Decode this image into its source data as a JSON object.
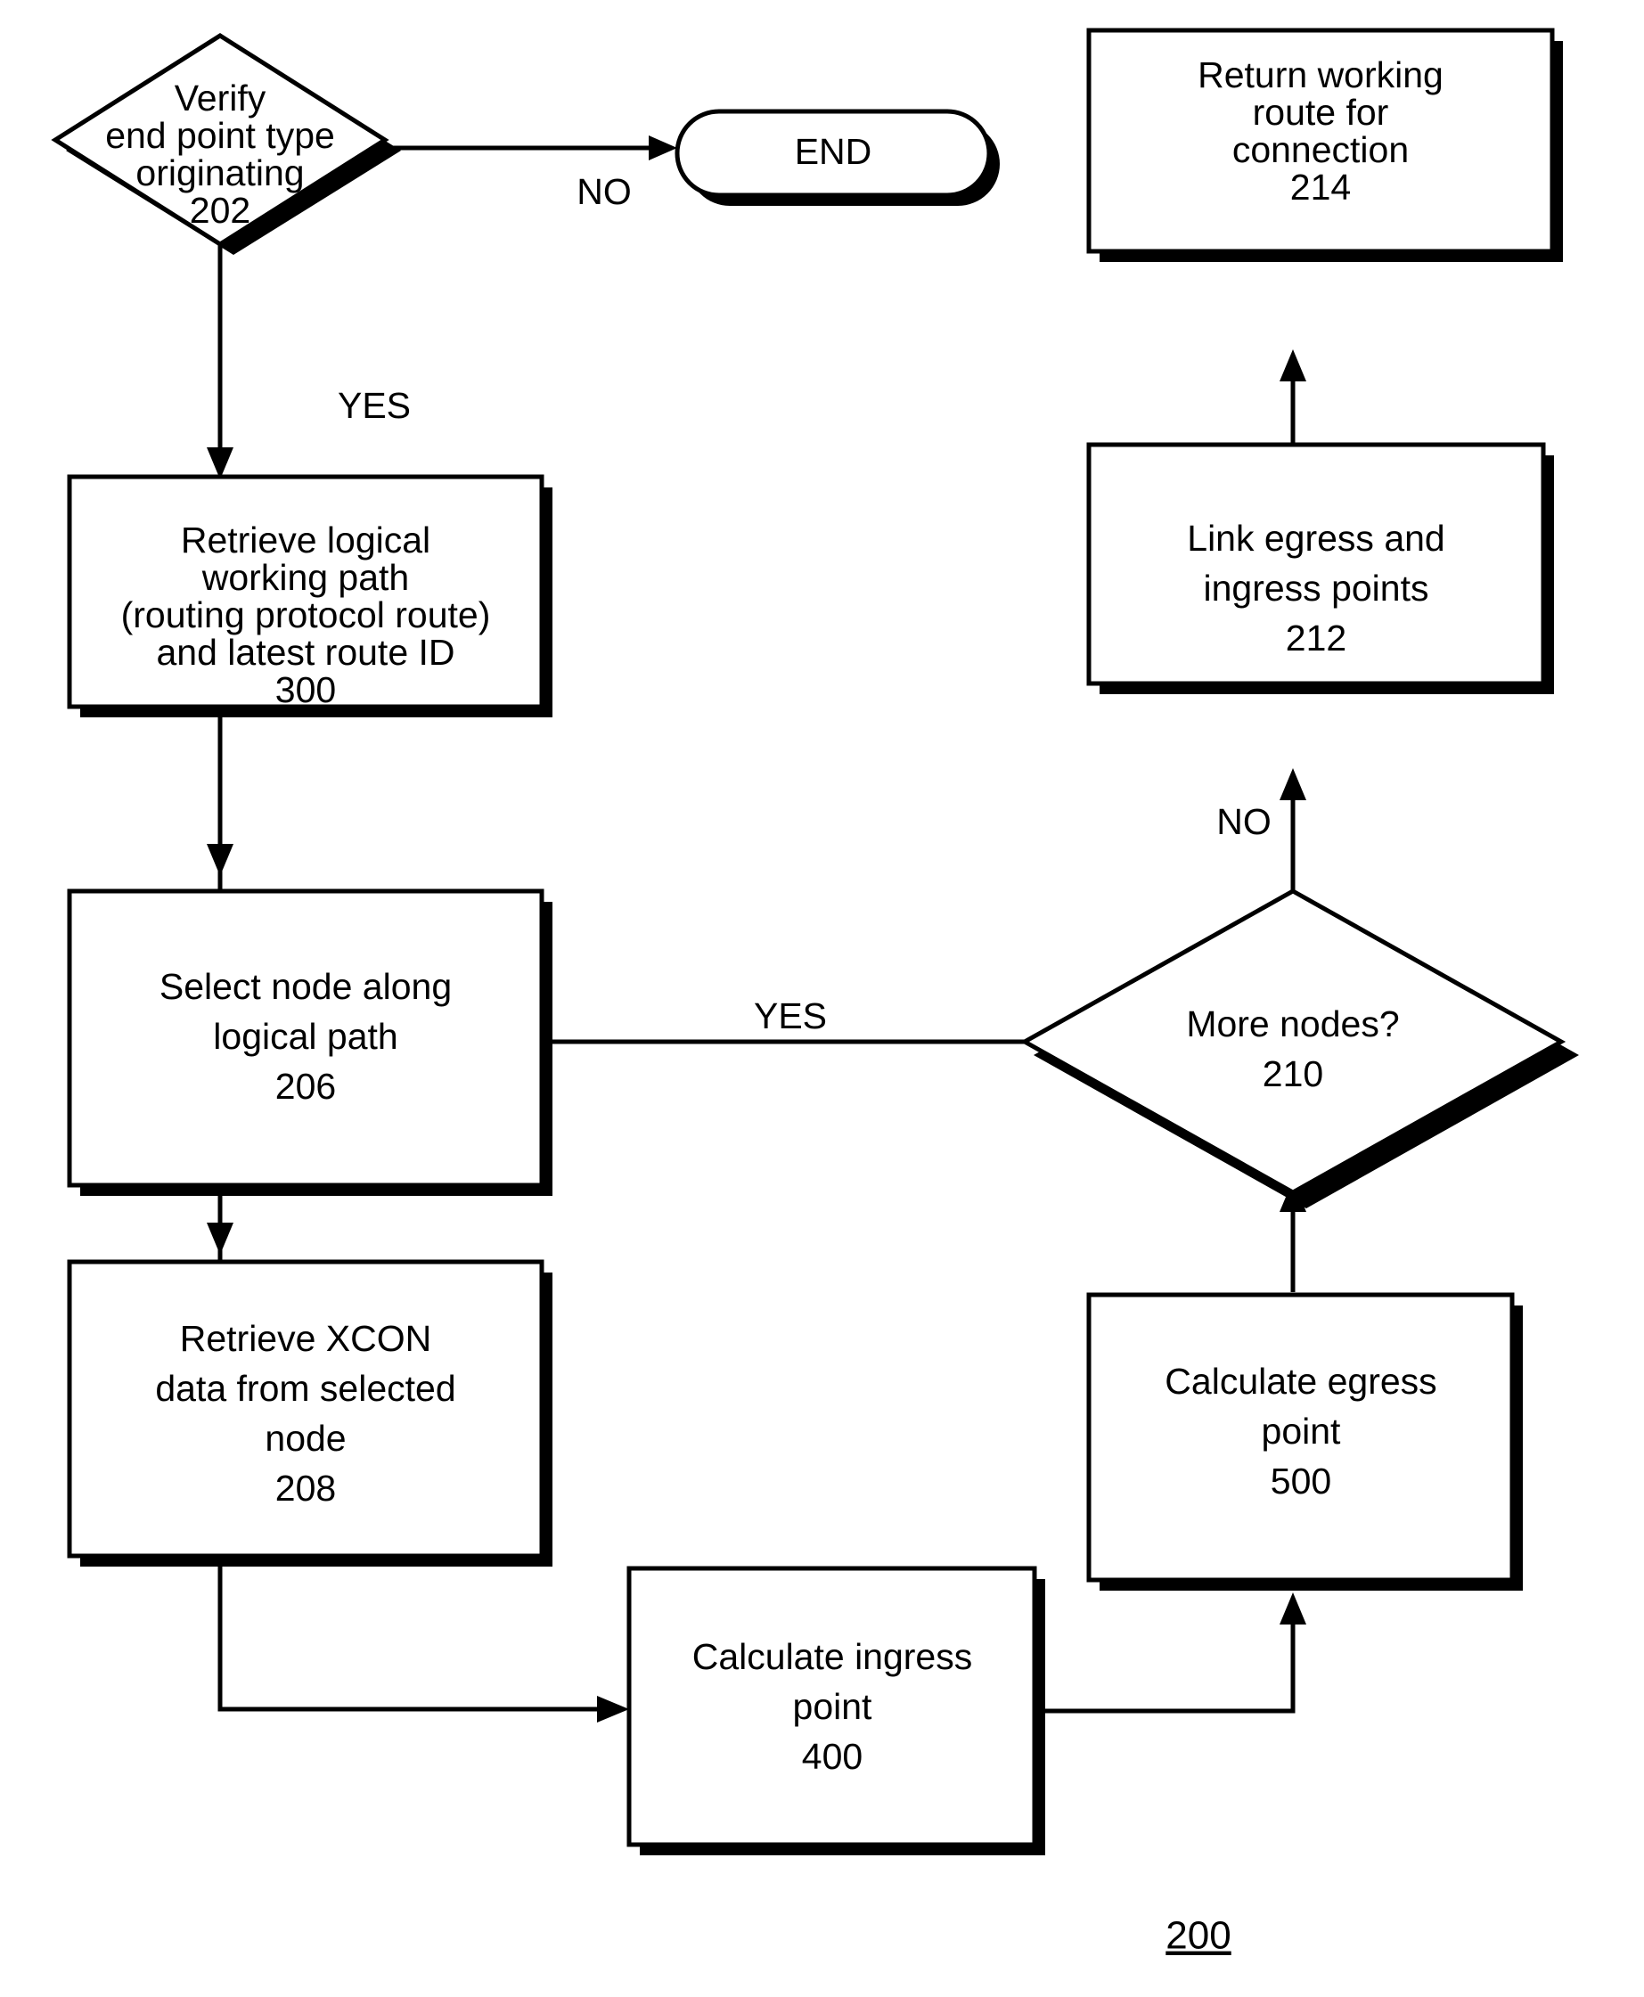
{
  "figure": {
    "number": "200",
    "type": "flowchart",
    "background_color": "#ffffff",
    "line_color": "#000000"
  },
  "nodes": {
    "verify": {
      "shape": "decision",
      "lines": [
        "Verify",
        "end point type",
        "originating",
        "202"
      ],
      "ref": "202"
    },
    "end": {
      "shape": "terminator",
      "lines": [
        "END"
      ],
      "ref": ""
    },
    "return_route": {
      "shape": "process",
      "lines": [
        "Return working",
        "route for",
        "connection",
        "214"
      ],
      "ref": "214"
    },
    "retrieve_path": {
      "shape": "process",
      "lines": [
        "Retrieve logical",
        "working path",
        "(routing protocol route)",
        "and latest route ID",
        "300"
      ],
      "ref": "300"
    },
    "link_points": {
      "shape": "process",
      "lines": [
        "Link egress and",
        "ingress points",
        "212"
      ],
      "ref": "212"
    },
    "select_node": {
      "shape": "process",
      "lines": [
        "Select node along",
        "logical path",
        "206"
      ],
      "ref": "206"
    },
    "more_nodes": {
      "shape": "decision",
      "lines": [
        "More nodes?",
        "210"
      ],
      "ref": "210"
    },
    "retrieve_xcon": {
      "shape": "process",
      "lines": [
        "Retrieve XCON",
        "data from selected",
        "node",
        "208"
      ],
      "ref": "208"
    },
    "calc_egress": {
      "shape": "process",
      "lines": [
        "Calculate egress",
        "point",
        "500"
      ],
      "ref": "500"
    },
    "calc_ingress": {
      "shape": "process",
      "lines": [
        "Calculate ingress",
        "point",
        "400"
      ],
      "ref": "400"
    }
  },
  "edge_labels": {
    "verify_no": "NO",
    "verify_yes": "YES",
    "more_nodes_yes": "YES",
    "more_nodes_no": "NO"
  }
}
